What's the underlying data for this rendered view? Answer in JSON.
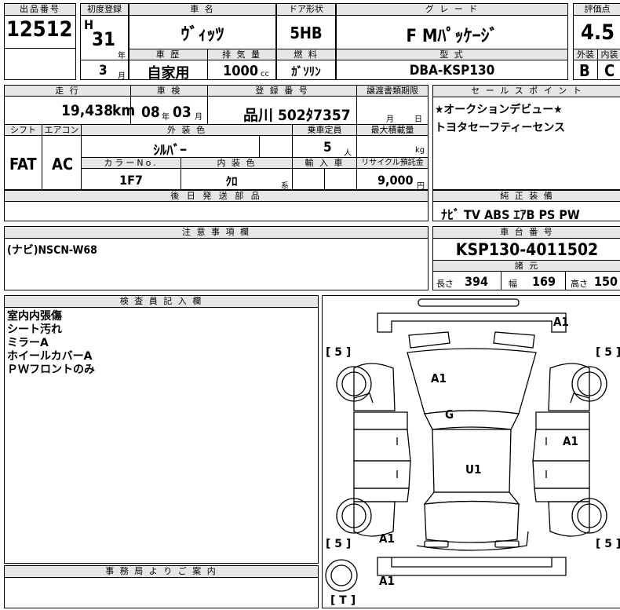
{
  "sheet": {
    "lot_label": "出品番号",
    "lot_number": "12512",
    "first_reg_label": "初度登録",
    "era": "H",
    "year": "31",
    "year_unit": "年",
    "month": "3",
    "month_unit": "月",
    "car_name_label": "車 名",
    "car_name": "ｳﾞｨｯﾂ",
    "history_label": "車 歴",
    "history": "自家用",
    "displacement_label": "排 気 量",
    "displacement": "1000",
    "displacement_unit": "cc",
    "door_label": "ドア形状",
    "door": "5HB",
    "fuel_label": "燃 料",
    "fuel": "ｶﾞｿﾘﾝ",
    "grade_label": "グ レ ー ド",
    "grade": "F Mﾊﾟｯｹｰｼﾞ",
    "model_label": "型 式",
    "model": "DBA-KSP130",
    "score_label": "評価点",
    "score": "4.5",
    "exterior_label": "外装",
    "exterior": "B",
    "interior_label": "内装",
    "interior": "C",
    "mileage_label": "走 行",
    "mileage": "19,438",
    "mileage_unit": "km",
    "inspection_label": "車 検",
    "inspection_year": "08",
    "inspection_year_unit": "年",
    "inspection_month": "03",
    "inspection_month_unit": "月",
    "registration_label": "登 録 番 号",
    "registration": "品川 502ﾀ7357",
    "transfer_label": "譲渡書類期限",
    "transfer_month_unit": "月",
    "transfer_day_unit": "日",
    "shift_label": "シフト",
    "shift": "FAT",
    "ac_label": "エアコン",
    "ac": "AC",
    "exterior_color_label": "外 装 色",
    "exterior_color": "ｼﾙﾊﾞｰ",
    "capacity_label": "乗車定員",
    "capacity": "5",
    "capacity_unit": "人",
    "max_load_label": "最大積載量",
    "max_load_unit": "kg",
    "color_no_label": "カラーNo.",
    "color_no": "1F7",
    "interior_color_label": "内 装 色",
    "interior_color": "ｸﾛ",
    "interior_color_unit": "系",
    "import_label": "輸 入 車",
    "recycle_label": "リサイクル預託金",
    "recycle": "9,000",
    "recycle_unit": "円",
    "later_parts_label": "後 日 発 送 部 品",
    "sales_label": "セ ー ル ス ポ イ ン ト",
    "sales_1": "★オークションデビュー★",
    "sales_2": "トヨタセーフティーセンス",
    "equipment_label": "純 正 装 備",
    "equipment": "ﾅﾋﾞ TV ABS ｴｱB PS PW",
    "notes_label": "注 意 事 項 欄",
    "notes": "(ナビ)NSCN-W68",
    "chassis_label": "車 台 番 号",
    "chassis": "KSP130-4011502",
    "specs_label": "諸 元",
    "length_label": "長さ",
    "length": "394",
    "width_label": "幅",
    "width": "169",
    "height_label": "高さ",
    "height": "150",
    "inspector_label": "検 査 員 記 入 欄",
    "inspector_lines": [
      "室内内張傷",
      "シート汚れ",
      "ミラーA",
      "ホイールカバーA",
      "ＰＷフロントのみ"
    ],
    "office_label": "事 務 局 よ り ご 案 内"
  },
  "diagram": {
    "marks": {
      "front_bumper": "A1",
      "hood": "A1",
      "roof": "G",
      "right_side": "A1",
      "body_center": "U1",
      "rear_left": "A1",
      "rear_bumper": "A1"
    },
    "tire_fl": "[ 5 ]",
    "tire_fr": "[ 5 ]",
    "tire_rl": "[ 5 ]",
    "tire_rr": "[ 5 ]",
    "spare": "[ T ]"
  }
}
